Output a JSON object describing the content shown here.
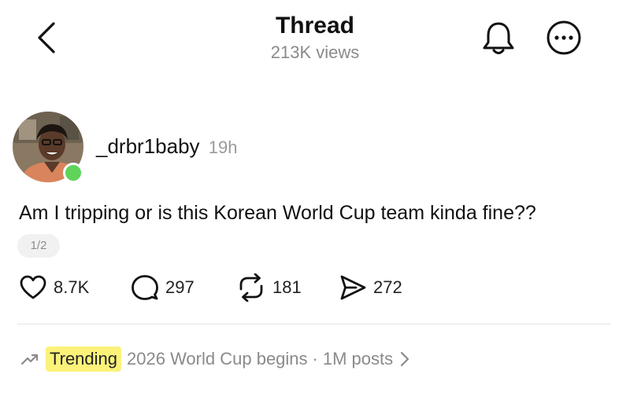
{
  "header": {
    "title": "Thread",
    "views": "213K views",
    "back_icon": "chevron-left-icon",
    "bell_icon": "bell-icon",
    "more_icon": "more-icon"
  },
  "post": {
    "author": {
      "username": "_drbr1baby",
      "time_ago": "19h",
      "online_color": "#5fd35a"
    },
    "text": "Am I tripping or is this Korean World Cup team kinda fine??",
    "page_indicator": "1/2",
    "actions": {
      "likes": "8.7K",
      "comments": "297",
      "reposts": "181",
      "shares": "272"
    }
  },
  "trending": {
    "label": "Trending",
    "topic": "2026 World Cup begins",
    "separator": "·",
    "count": "1M posts",
    "highlight_color": "#fbf27a"
  }
}
